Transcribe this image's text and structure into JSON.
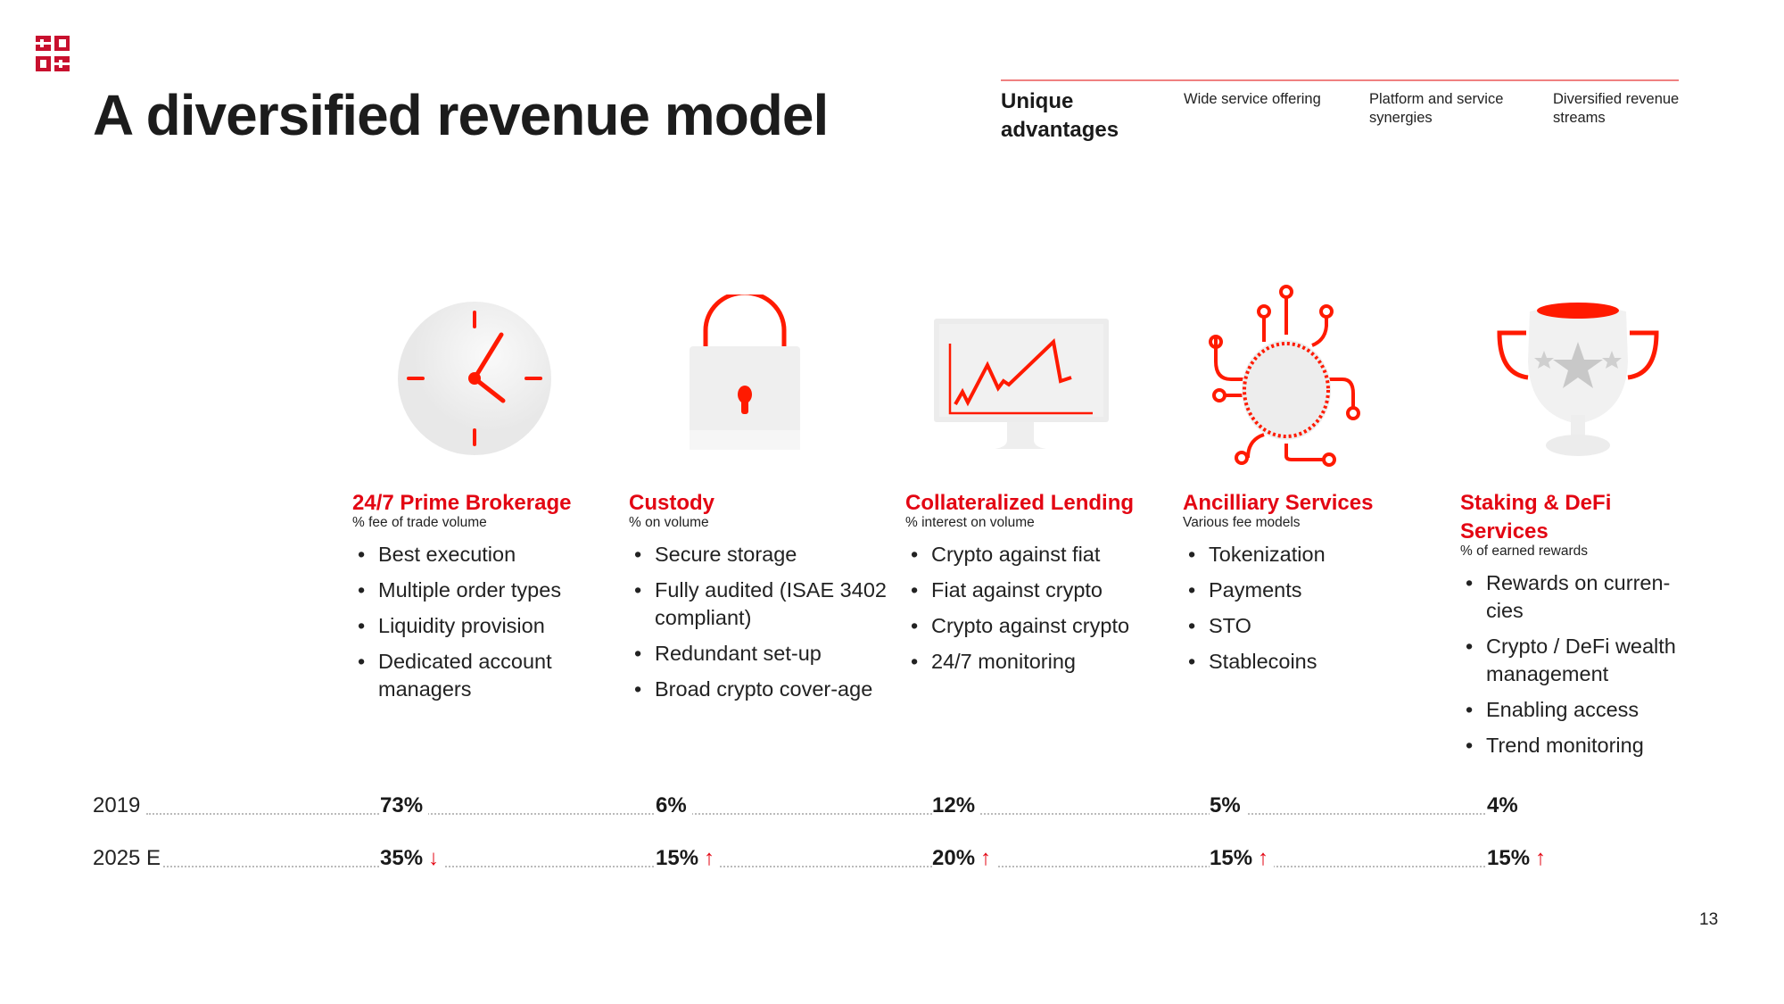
{
  "title": "A diversified revenue model",
  "advantages": {
    "heading": "Unique advantages",
    "items": [
      "Wide service offering",
      "Platform and service synergies",
      "Diversified revenue streams"
    ]
  },
  "colors": {
    "accent": "#e30613",
    "text": "#1a1a1a",
    "icon_fill": "#eeeeee"
  },
  "services": [
    {
      "name": "24/7 Prime Brokerage",
      "fee_model": "% fee of trade volume",
      "icon": "clock-icon",
      "bullets": [
        "Best execution",
        "Multiple order types",
        "Liquidity provision",
        "Dedicated account managers"
      ]
    },
    {
      "name": "Custody",
      "fee_model": "% on volume",
      "icon": "lock-icon",
      "bullets": [
        "Secure storage",
        "Fully audited (ISAE 3402 compliant)",
        "Redundant set-up",
        "Broad crypto cover-age"
      ]
    },
    {
      "name": "Collateralized Lending",
      "fee_model": "% interest on volume",
      "icon": "chart-monitor-icon",
      "bullets": [
        "Crypto against fiat",
        "Fiat against crypto",
        "Crypto against crypto",
        "24/7 monitoring"
      ]
    },
    {
      "name": "Ancilliary Services",
      "fee_model": "Various fee models",
      "icon": "circuit-chip-icon",
      "bullets": [
        "Tokenization",
        "Payments",
        "STO",
        "Stablecoins"
      ]
    },
    {
      "name": "Staking & DeFi Services",
      "fee_model": "% of earned rewards",
      "icon": "trophy-icon",
      "bullets": [
        "Rewards on curren-cies",
        "Crypto / DeFi wealth management",
        "Enabling access",
        "Trend monitoring"
      ]
    }
  ],
  "revenue_share": [
    {
      "label": "2019",
      "values": [
        {
          "value": "73%",
          "trend": ""
        },
        {
          "value": "6%",
          "trend": ""
        },
        {
          "value": "12%",
          "trend": ""
        },
        {
          "value": "5%",
          "trend": ""
        },
        {
          "value": "4%",
          "trend": ""
        }
      ]
    },
    {
      "label": "2025 E",
      "values": [
        {
          "value": "35%",
          "trend": "↓"
        },
        {
          "value": "15%",
          "trend": "↑"
        },
        {
          "value": "20%",
          "trend": "↑"
        },
        {
          "value": "15%",
          "trend": "↑"
        },
        {
          "value": "15%",
          "trend": "↑"
        }
      ]
    }
  ],
  "page_number": "13"
}
